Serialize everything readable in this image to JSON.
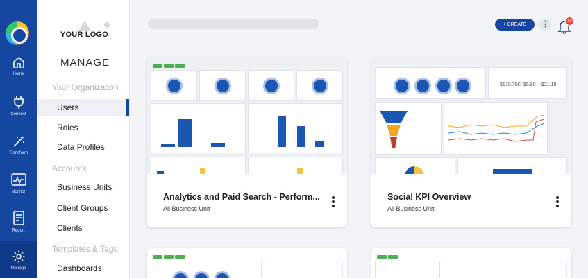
{
  "rail": {
    "items": [
      {
        "label": "Home",
        "icon": "home-icon"
      },
      {
        "label": "Connect",
        "icon": "plug-icon"
      },
      {
        "label": "Transform",
        "icon": "magic-wand-icon"
      },
      {
        "label": "Monitor",
        "icon": "pulse-icon"
      },
      {
        "label": "Report",
        "icon": "report-icon"
      },
      {
        "label": "Manage",
        "icon": "gear-icon"
      }
    ]
  },
  "panel": {
    "logo": "YOUR LOGO",
    "title": "MANAGE",
    "sections": [
      {
        "label": "Your Organization"
      },
      {
        "label": "Accounts"
      },
      {
        "label": "Templates & Tags"
      }
    ],
    "items": [
      {
        "label": "Users"
      },
      {
        "label": "Roles"
      },
      {
        "label": "Data Profiles"
      },
      {
        "label": "Business Units"
      },
      {
        "label": "Client Groups"
      },
      {
        "label": "Clients"
      },
      {
        "label": "Dashboards"
      }
    ]
  },
  "header": {
    "create_label": "+ CREATE",
    "more_label": "⋮",
    "notification_count": "10"
  },
  "cards": [
    {
      "title": "Analytics and Paid Search - Perform...",
      "subtitle": "All Business Unit"
    },
    {
      "title": "Social KPI Overview",
      "subtitle": "All Business Unit"
    }
  ],
  "thumb2_kpis": [
    "$170.75K",
    "$5.80",
    "$21.19"
  ],
  "colors": {
    "brand": "#1546a0",
    "accent": "#1c56b3",
    "badge": "#e2463f"
  }
}
